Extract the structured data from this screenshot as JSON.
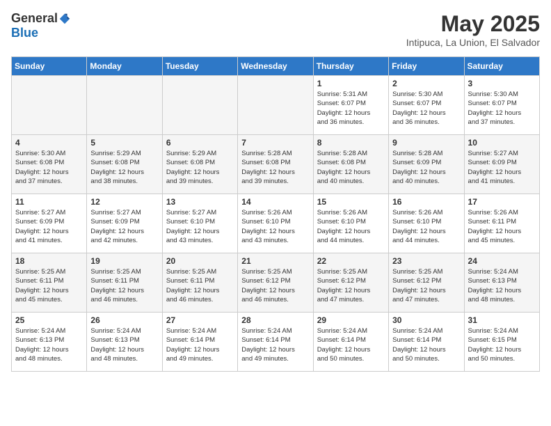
{
  "header": {
    "logo_general": "General",
    "logo_blue": "Blue",
    "month": "May 2025",
    "location": "Intipuca, La Union, El Salvador"
  },
  "days_of_week": [
    "Sunday",
    "Monday",
    "Tuesday",
    "Wednesday",
    "Thursday",
    "Friday",
    "Saturday"
  ],
  "weeks": [
    [
      {
        "day": "",
        "info": ""
      },
      {
        "day": "",
        "info": ""
      },
      {
        "day": "",
        "info": ""
      },
      {
        "day": "",
        "info": ""
      },
      {
        "day": "1",
        "info": "Sunrise: 5:31 AM\nSunset: 6:07 PM\nDaylight: 12 hours\nand 36 minutes."
      },
      {
        "day": "2",
        "info": "Sunrise: 5:30 AM\nSunset: 6:07 PM\nDaylight: 12 hours\nand 36 minutes."
      },
      {
        "day": "3",
        "info": "Sunrise: 5:30 AM\nSunset: 6:07 PM\nDaylight: 12 hours\nand 37 minutes."
      }
    ],
    [
      {
        "day": "4",
        "info": "Sunrise: 5:30 AM\nSunset: 6:08 PM\nDaylight: 12 hours\nand 37 minutes."
      },
      {
        "day": "5",
        "info": "Sunrise: 5:29 AM\nSunset: 6:08 PM\nDaylight: 12 hours\nand 38 minutes."
      },
      {
        "day": "6",
        "info": "Sunrise: 5:29 AM\nSunset: 6:08 PM\nDaylight: 12 hours\nand 39 minutes."
      },
      {
        "day": "7",
        "info": "Sunrise: 5:28 AM\nSunset: 6:08 PM\nDaylight: 12 hours\nand 39 minutes."
      },
      {
        "day": "8",
        "info": "Sunrise: 5:28 AM\nSunset: 6:08 PM\nDaylight: 12 hours\nand 40 minutes."
      },
      {
        "day": "9",
        "info": "Sunrise: 5:28 AM\nSunset: 6:09 PM\nDaylight: 12 hours\nand 40 minutes."
      },
      {
        "day": "10",
        "info": "Sunrise: 5:27 AM\nSunset: 6:09 PM\nDaylight: 12 hours\nand 41 minutes."
      }
    ],
    [
      {
        "day": "11",
        "info": "Sunrise: 5:27 AM\nSunset: 6:09 PM\nDaylight: 12 hours\nand 41 minutes."
      },
      {
        "day": "12",
        "info": "Sunrise: 5:27 AM\nSunset: 6:09 PM\nDaylight: 12 hours\nand 42 minutes."
      },
      {
        "day": "13",
        "info": "Sunrise: 5:27 AM\nSunset: 6:10 PM\nDaylight: 12 hours\nand 43 minutes."
      },
      {
        "day": "14",
        "info": "Sunrise: 5:26 AM\nSunset: 6:10 PM\nDaylight: 12 hours\nand 43 minutes."
      },
      {
        "day": "15",
        "info": "Sunrise: 5:26 AM\nSunset: 6:10 PM\nDaylight: 12 hours\nand 44 minutes."
      },
      {
        "day": "16",
        "info": "Sunrise: 5:26 AM\nSunset: 6:10 PM\nDaylight: 12 hours\nand 44 minutes."
      },
      {
        "day": "17",
        "info": "Sunrise: 5:26 AM\nSunset: 6:11 PM\nDaylight: 12 hours\nand 45 minutes."
      }
    ],
    [
      {
        "day": "18",
        "info": "Sunrise: 5:25 AM\nSunset: 6:11 PM\nDaylight: 12 hours\nand 45 minutes."
      },
      {
        "day": "19",
        "info": "Sunrise: 5:25 AM\nSunset: 6:11 PM\nDaylight: 12 hours\nand 46 minutes."
      },
      {
        "day": "20",
        "info": "Sunrise: 5:25 AM\nSunset: 6:11 PM\nDaylight: 12 hours\nand 46 minutes."
      },
      {
        "day": "21",
        "info": "Sunrise: 5:25 AM\nSunset: 6:12 PM\nDaylight: 12 hours\nand 46 minutes."
      },
      {
        "day": "22",
        "info": "Sunrise: 5:25 AM\nSunset: 6:12 PM\nDaylight: 12 hours\nand 47 minutes."
      },
      {
        "day": "23",
        "info": "Sunrise: 5:25 AM\nSunset: 6:12 PM\nDaylight: 12 hours\nand 47 minutes."
      },
      {
        "day": "24",
        "info": "Sunrise: 5:24 AM\nSunset: 6:13 PM\nDaylight: 12 hours\nand 48 minutes."
      }
    ],
    [
      {
        "day": "25",
        "info": "Sunrise: 5:24 AM\nSunset: 6:13 PM\nDaylight: 12 hours\nand 48 minutes."
      },
      {
        "day": "26",
        "info": "Sunrise: 5:24 AM\nSunset: 6:13 PM\nDaylight: 12 hours\nand 48 minutes."
      },
      {
        "day": "27",
        "info": "Sunrise: 5:24 AM\nSunset: 6:14 PM\nDaylight: 12 hours\nand 49 minutes."
      },
      {
        "day": "28",
        "info": "Sunrise: 5:24 AM\nSunset: 6:14 PM\nDaylight: 12 hours\nand 49 minutes."
      },
      {
        "day": "29",
        "info": "Sunrise: 5:24 AM\nSunset: 6:14 PM\nDaylight: 12 hours\nand 50 minutes."
      },
      {
        "day": "30",
        "info": "Sunrise: 5:24 AM\nSunset: 6:14 PM\nDaylight: 12 hours\nand 50 minutes."
      },
      {
        "day": "31",
        "info": "Sunrise: 5:24 AM\nSunset: 6:15 PM\nDaylight: 12 hours\nand 50 minutes."
      }
    ]
  ]
}
